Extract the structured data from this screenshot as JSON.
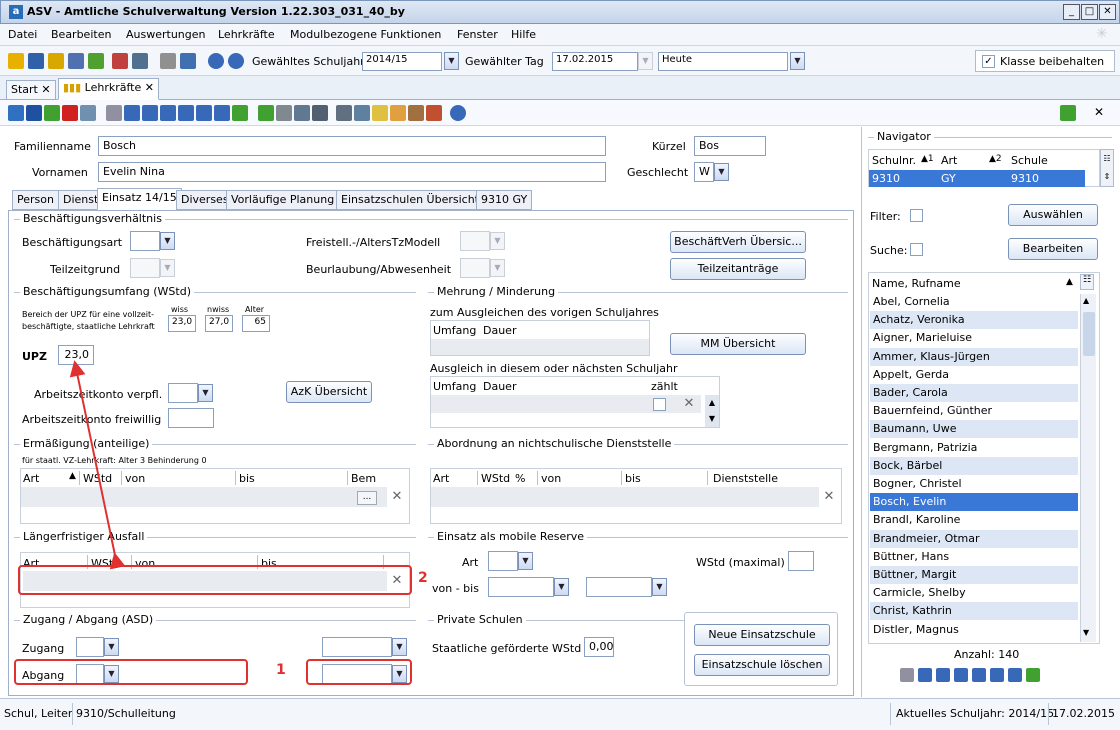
{
  "window": {
    "title": "ASV - Amtliche Schulverwaltung Version 1.22.303_031_40_by"
  },
  "menu": [
    "Datei",
    "Bearbeiten",
    "Auswertungen",
    "Lehrkräfte",
    "Modulbezogene Funktionen",
    "Fenster",
    "Hilfe"
  ],
  "toolbar": {
    "schuljahr_label": "Gewähltes Schuljahr",
    "schuljahr_value": "2014/15",
    "tag_label": "Gewählter Tag",
    "tag_value": "17.02.2015",
    "heute_value": "Heute",
    "klasse_label": "Klasse beibehalten"
  },
  "doc_tabs": [
    "Start",
    "Lehrkräfte"
  ],
  "form": {
    "familienname_label": "Familienname",
    "familienname_value": "Bosch",
    "vornamen_label": "Vornamen",
    "vornamen_value": "Evelin Nina",
    "kuerzel_label": "Kürzel",
    "kuerzel_value": "Bos",
    "geschlecht_label": "Geschlecht",
    "geschlecht_value": "W"
  },
  "tabs": [
    "Person",
    "Dienst",
    "Einsatz 14/15",
    "Diverses",
    "Vorläufige Planung",
    "Einsatzschulen Übersicht",
    "9310 GY"
  ],
  "bv": {
    "title": "Beschäftigungsverhältnis",
    "art": "Beschäftigungsart",
    "teilzeitgrund": "Teilzeitgrund",
    "freistell": "Freistell.-/AltersTzModell",
    "beurlaubung": "Beurlaubung/Abwesenheit",
    "btn_uebersicht": "BeschäftVerh Übersic...",
    "btn_teilzeit": "Teilzeitanträge"
  },
  "bu": {
    "title": "Beschäftigungsumfang (WStd)",
    "desc1": "Bereich der UPZ für eine vollzeit-",
    "desc2": "beschäftigte, staatliche Lehrkraft",
    "wiss_label": "wiss",
    "nwiss_label": "nwiss",
    "alter_label": "Alter",
    "wiss": "23,0",
    "nwiss": "27,0",
    "alter": "65",
    "upz_label": "UPZ",
    "upz": "23,0",
    "azk_verpfl": "Arbeitszeitkonto verpfl.",
    "azk_frei": "Arbeitszeitkonto freiwillig",
    "btn_azk": "AzK Übersicht"
  },
  "mm": {
    "title": "Mehrung / Minderung",
    "vorjahr": "zum Ausgleichen des vorigen Schuljahres",
    "umfang": "Umfang",
    "dauer": "Dauer",
    "btn_mm": "MM Übersicht",
    "ausgleich": "Ausgleich in diesem oder nächsten Schuljahr",
    "zaehlt": "zählt"
  },
  "erm": {
    "title": "Ermäßigung (anteilige)",
    "note": "für staatl. VZ-Lehrkraft: Alter 3 Behinderung 0",
    "cols": [
      "Art",
      "WStd",
      "von",
      "bis",
      "Bem"
    ]
  },
  "abordnung": {
    "title": "Abordnung an nichtschulische Dienststelle",
    "cols": [
      "Art",
      "WStd",
      "%",
      "von",
      "bis",
      "Dienststelle"
    ]
  },
  "ausfall": {
    "title": "Längerfristiger Ausfall",
    "cols": [
      "Art",
      "WStd",
      "von",
      "bis"
    ]
  },
  "mobil": {
    "title": "Einsatz als mobile Reserve",
    "art": "Art",
    "wstd_max": "WStd (maximal)",
    "vonbis": "von - bis"
  },
  "zugang": {
    "title": "Zugang / Abgang (ASD)",
    "zugang": "Zugang",
    "abgang": "Abgang"
  },
  "privat": {
    "title": "Private Schulen",
    "label": "Staatliche geförderte WStd",
    "value": "0,00",
    "btn_neu": "Neue Einsatzschule",
    "btn_loeschen": "Einsatzschule löschen"
  },
  "annotations": {
    "n1": "1",
    "n2": "2"
  },
  "navigator": {
    "title": "Navigator",
    "cols": [
      "Schulnr.",
      "Art",
      "Schule"
    ],
    "sort1": "▲1",
    "sort2": "▲2",
    "row": [
      "9310",
      "GY",
      "9310"
    ],
    "filter": "Filter:",
    "suche": "Suche:",
    "btn_auswaehlen": "Auswählen",
    "btn_bearbeiten": "Bearbeiten",
    "list_header": "Name, Rufname",
    "names": [
      "Abel, Cornelia",
      "Achatz, Veronika",
      "Aigner, Marieluise",
      "Ammer, Klaus-Jürgen",
      "Appelt, Gerda",
      "Bader, Carola",
      "Bauernfeind, Günther",
      "Baumann, Uwe",
      "Bergmann, Patrizia",
      "Bock, Bärbel",
      "Bogner, Christel",
      "Bosch, Evelin",
      "Brandl, Karoline",
      "Brandmeier, Otmar",
      "Büttner, Hans",
      "Büttner, Margit",
      "Carmicle, Shelby",
      "Christ, Kathrin",
      "Distler, Magnus"
    ],
    "selected_index": 11,
    "count": "Anzahl: 140"
  },
  "status": {
    "user": "Schul, Leiter",
    "role": "9310/Schulleitung",
    "schuljahr": "Aktuelles Schuljahr: 2014/15",
    "date": "17.02.2015"
  }
}
